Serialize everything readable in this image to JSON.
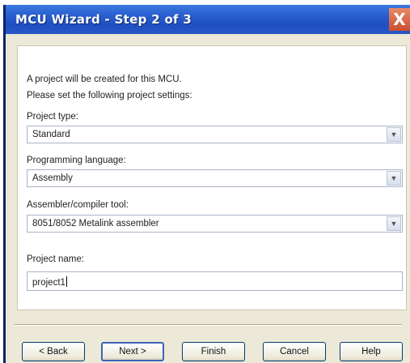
{
  "window": {
    "title": "MCU Wizard - Step 2 of 3",
    "close_label": "X"
  },
  "intro": {
    "line1": "A project will be created for this MCU.",
    "line2": "Please set the following project settings:"
  },
  "project_type": {
    "label": "Project type:",
    "value": "Standard"
  },
  "programming_language": {
    "label": "Programming language:",
    "value": "Assembly"
  },
  "tool": {
    "label": "Assembler/compiler tool:",
    "value": "8051/8052 Metalink assembler"
  },
  "project_name": {
    "label": "Project name:",
    "value": "project1"
  },
  "buttons": {
    "back": "< Back",
    "next": "Next >",
    "finish": "Finish",
    "cancel": "Cancel",
    "help": "Help"
  },
  "colors": {
    "titlebar": "#2a5fd0",
    "dialog_bg": "#ece9d8"
  },
  "icons": {
    "dropdown": "chevron-down-icon",
    "close": "close-icon"
  }
}
